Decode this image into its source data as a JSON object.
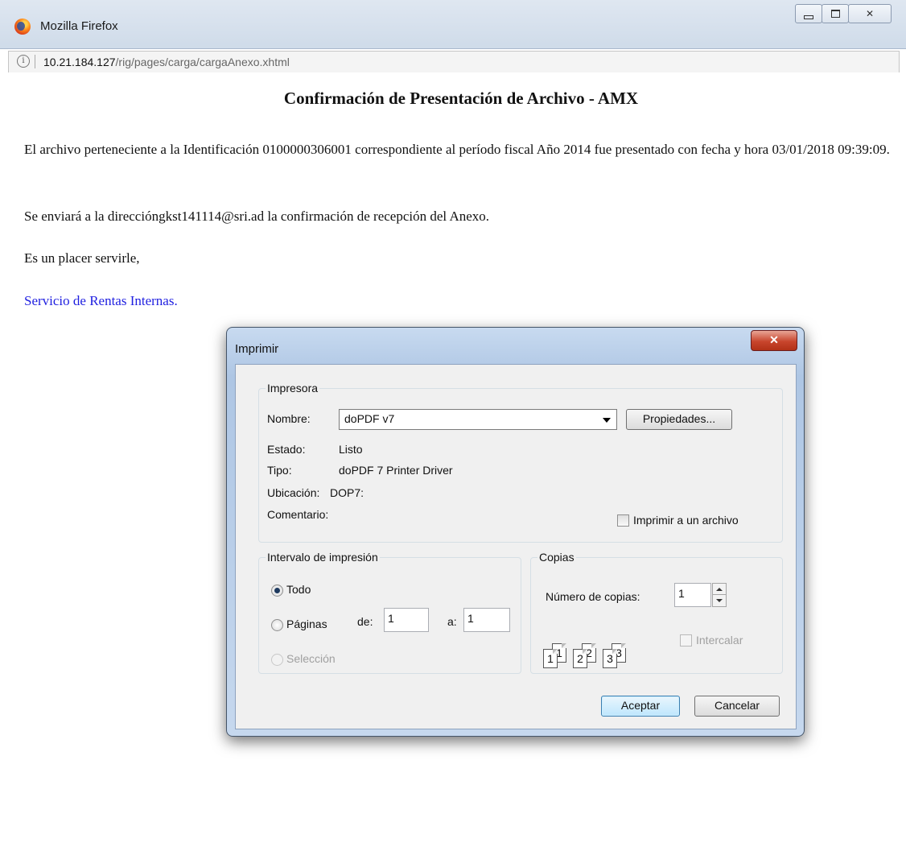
{
  "window": {
    "title": "Mozilla Firefox"
  },
  "addressbar": {
    "host": "10.21.184.127",
    "path": "/rig/pages/carga/cargaAnexo.xhtml"
  },
  "page": {
    "heading": "Confirmación de Presentación de Archivo - AMX",
    "paragraph1": "El archivo perteneciente a la Identificación 0100000306001 correspondiente al período fiscal Año 2014 fue presentado con fecha y hora 03/01/2018 09:39:09.",
    "paragraph2": "Se enviará a la direccióngkst141114@sri.ad la confirmación de recepción del Anexo.",
    "paragraph3": "Es un placer servirle,",
    "signature": "Servicio de Rentas Internas."
  },
  "dialog": {
    "title": "Imprimir",
    "printer": {
      "group_label": "Impresora",
      "name_label": "Nombre:",
      "name_value": "doPDF v7",
      "properties_button": "Propiedades...",
      "status_label": "Estado:",
      "status_value": "Listo",
      "type_label": "Tipo:",
      "type_value": "doPDF 7 Printer Driver",
      "location_label": "Ubicación:",
      "location_value": "DOP7:",
      "comment_label": "Comentario:",
      "print_to_file_label": "Imprimir a un archivo",
      "print_to_file_checked": false
    },
    "range": {
      "group_label": "Intervalo de impresión",
      "all_label": "Todo",
      "pages_label": "Páginas",
      "from_label": "de:",
      "from_value": "1",
      "to_label": "a:",
      "to_value": "1",
      "selection_label": "Selección",
      "selected_option": "Todo"
    },
    "copies": {
      "group_label": "Copias",
      "count_label": "Número de copias:",
      "count_value": "1",
      "collate_label": "Intercalar",
      "collate_checked": false,
      "collate_icon_pages": [
        "1",
        "1",
        "2",
        "2",
        "3",
        "3"
      ]
    },
    "buttons": {
      "ok": "Aceptar",
      "cancel": "Cancelar"
    }
  }
}
